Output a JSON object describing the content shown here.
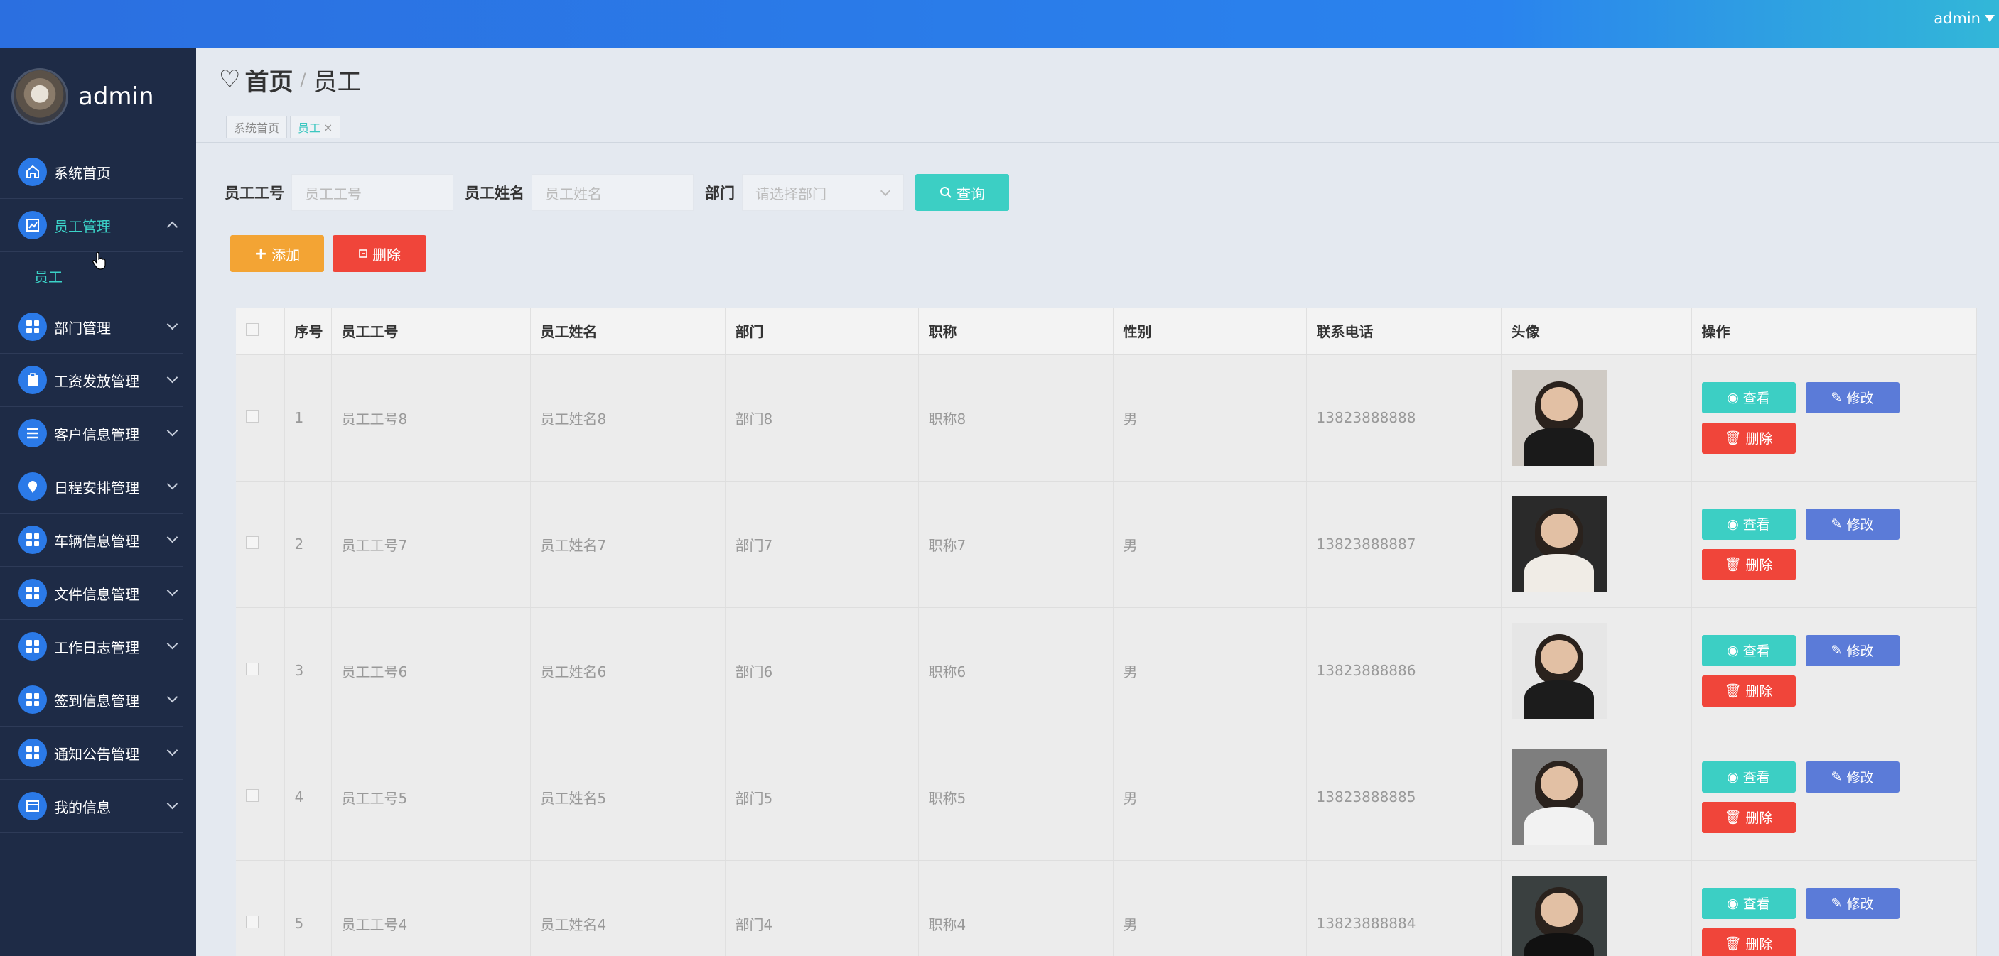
{
  "topbar": {
    "username": "admin"
  },
  "sidebar": {
    "profile_name": "admin",
    "items": [
      {
        "label": "系统首页",
        "icon": "home-icon"
      },
      {
        "label": "员工管理",
        "icon": "chart-icon",
        "expanded": true,
        "children": [
          "员工"
        ]
      },
      {
        "label": "部门管理",
        "icon": "grid-icon"
      },
      {
        "label": "工资发放管理",
        "icon": "clipboard-icon"
      },
      {
        "label": "客户信息管理",
        "icon": "list-icon"
      },
      {
        "label": "日程安排管理",
        "icon": "pin-icon"
      },
      {
        "label": "车辆信息管理",
        "icon": "grid-icon"
      },
      {
        "label": "文件信息管理",
        "icon": "grid-icon"
      },
      {
        "label": "工作日志管理",
        "icon": "grid-icon"
      },
      {
        "label": "签到信息管理",
        "icon": "grid-icon"
      },
      {
        "label": "通知公告管理",
        "icon": "grid-icon"
      },
      {
        "label": "我的信息",
        "icon": "card-icon"
      }
    ]
  },
  "breadcrumb": {
    "home": "首页",
    "separator": "/",
    "current": "员工"
  },
  "tags": [
    {
      "label": "系统首页"
    },
    {
      "label": "员工",
      "active": true
    }
  ],
  "search": {
    "emp_no_label": "员工工号",
    "emp_no_placeholder": "员工工号",
    "emp_name_label": "员工姓名",
    "emp_name_placeholder": "员工姓名",
    "dept_label": "部门",
    "dept_placeholder": "请选择部门",
    "query_button": "查询"
  },
  "actions": {
    "add": "添加",
    "delete": "删除"
  },
  "table": {
    "headers": [
      "序号",
      "员工工号",
      "员工姓名",
      "部门",
      "职称",
      "性别",
      "联系电话",
      "头像",
      "操作"
    ],
    "row_buttons": {
      "view": "查看",
      "edit": "修改",
      "delete": "删除"
    },
    "rows": [
      {
        "no": "1",
        "emp_no": "员工工号8",
        "emp_name": "员工姓名8",
        "dept": "部门8",
        "title": "职称8",
        "gender": "男",
        "phone": "13823888888"
      },
      {
        "no": "2",
        "emp_no": "员工工号7",
        "emp_name": "员工姓名7",
        "dept": "部门7",
        "title": "职称7",
        "gender": "男",
        "phone": "13823888887"
      },
      {
        "no": "3",
        "emp_no": "员工工号6",
        "emp_name": "员工姓名6",
        "dept": "部门6",
        "title": "职称6",
        "gender": "男",
        "phone": "13823888886"
      },
      {
        "no": "4",
        "emp_no": "员工工号5",
        "emp_name": "员工姓名5",
        "dept": "部门5",
        "title": "职称5",
        "gender": "男",
        "phone": "13823888885"
      },
      {
        "no": "5",
        "emp_no": "员工工号4",
        "emp_name": "员工姓名4",
        "dept": "部门4",
        "title": "职称4",
        "gender": "男",
        "phone": "13823888884"
      }
    ]
  },
  "colors": {
    "sidebar_bg": "#1e2b46",
    "accent_teal": "#3ccfc4",
    "accent_blue": "#2b7ae8",
    "danger": "#f0453a",
    "warning": "#f3a434",
    "edit_blue": "#5b7bd8"
  }
}
